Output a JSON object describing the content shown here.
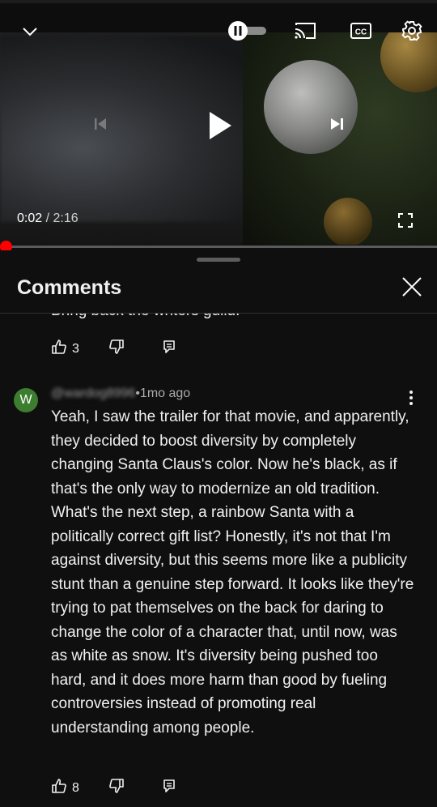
{
  "player": {
    "current_time": "0:02",
    "separator": " / ",
    "duration": "2:16",
    "progress_fraction": 0.015
  },
  "comments_panel": {
    "title": "Comments",
    "previous_comment": {
      "text_cutoff": "Bring back the writers guild!",
      "likes": "3"
    },
    "comment": {
      "avatar_letter": "W",
      "author": "@wardog8996",
      "dot": " • ",
      "age": "1mo ago",
      "text": "Yeah, I saw the trailer for that movie, and apparently, they decided to boost diversity by completely changing Santa Claus's color. Now he's black, as if that's the only way to modernize an old tradition. What's the next step, a rainbow Santa with a politically correct gift list? Honestly, it's not that I'm against diversity, but this seems more like a publicity stunt than a genuine step forward. It looks like they're trying to pat themselves on the back for daring to change the color of a character that, until now, was as white as snow. It's diversity being pushed too hard, and it does more harm than good by fueling controversies instead of promoting real understanding among people.",
      "likes": "8",
      "avatar_color": "#3d7d2f"
    }
  },
  "icons": {
    "collapse": "chevron-down-icon",
    "autoplay": "autoplay-toggle-icon",
    "cast": "cast-icon",
    "captions": "captions-icon",
    "settings": "gear-icon",
    "previous": "skip-previous-icon",
    "play": "play-icon",
    "next": "skip-next-icon",
    "fullscreen": "fullscreen-icon",
    "close": "close-icon",
    "like": "thumbs-up-icon",
    "dislike": "thumbs-down-icon",
    "reply": "reply-icon",
    "more": "more-vertical-icon"
  },
  "colors": {
    "accent": "#ff0000",
    "background": "#0f0f0f"
  }
}
